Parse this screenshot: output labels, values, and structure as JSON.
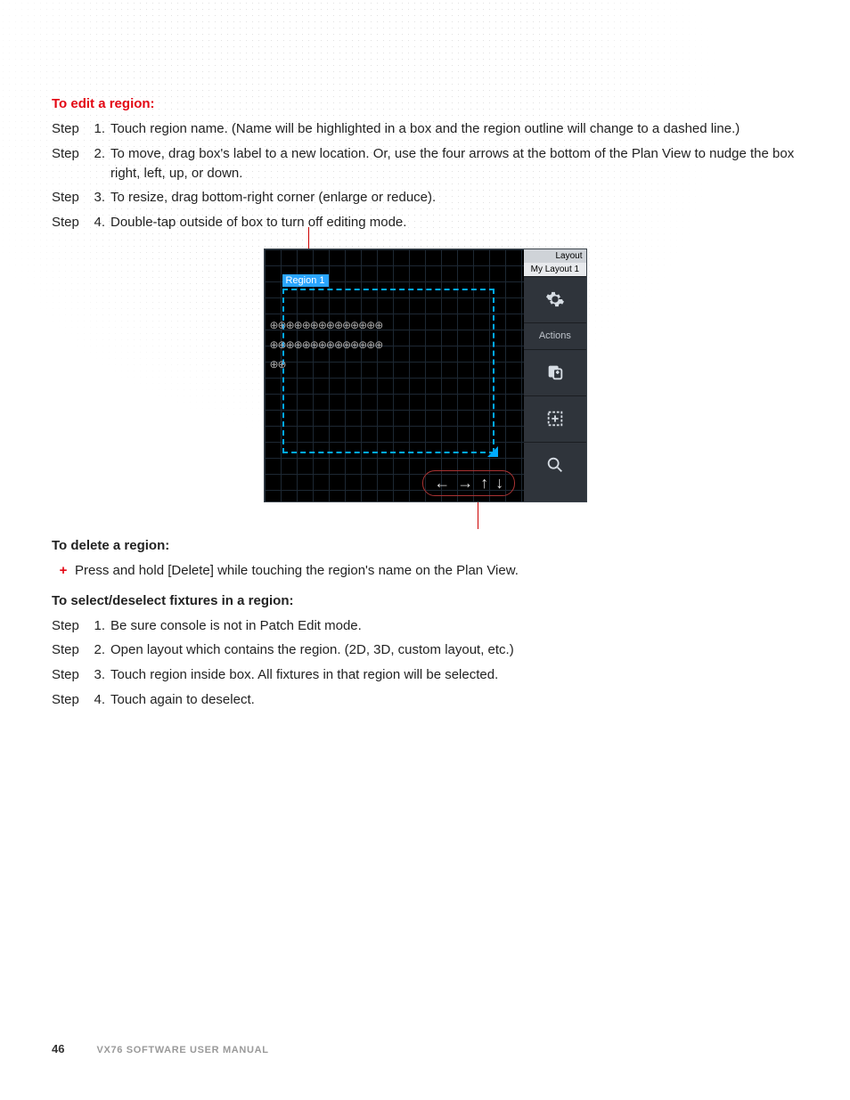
{
  "headings": {
    "edit": "To edit a region:",
    "delete": "To delete a region:",
    "select": "To select/deselect fixtures in a region:"
  },
  "step_word": "Step",
  "edit_steps": [
    "Touch region name. (Name will be highlighted in a box and the region outline will change to a dashed line.)",
    "To move, drag box's label to a new location. Or, use the four arrows at the bottom of the Plan View to nudge the box right, left, up, or down.",
    "To resize, drag bottom-right corner (enlarge or reduce).",
    "Double-tap outside of box to turn off editing mode."
  ],
  "delete_bullets": [
    "Press and hold [Delete] while touching the region's name on the Plan View."
  ],
  "select_steps": [
    "Be sure console is not in Patch Edit mode.",
    "Open layout which contains the region. (2D, 3D, custom layout, etc.)",
    "Touch region inside box. All fixtures in that region will be selected.",
    "Touch again to deselect."
  ],
  "figure": {
    "region_label": "Region 1",
    "sidebar": {
      "head": "Layout",
      "subhead": "My Layout 1",
      "actions_label": "Actions"
    },
    "arrows": {
      "left": "←",
      "right": "→",
      "up": "↑",
      "down": "↓"
    }
  },
  "footer": {
    "page": "46",
    "manual": "VX76 SOFTWARE USER MANUAL"
  }
}
